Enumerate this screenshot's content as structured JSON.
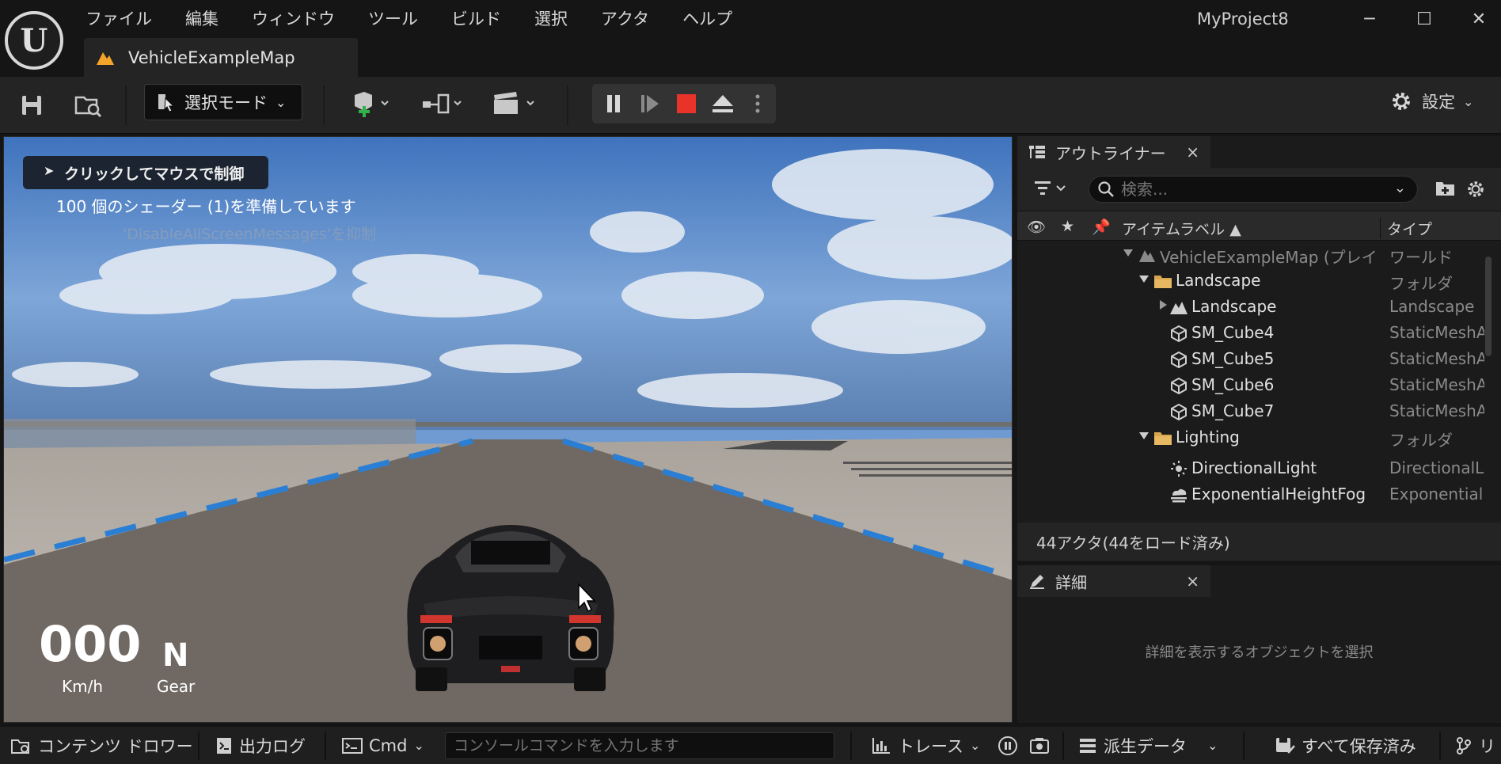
{
  "app": {
    "project_name": "MyProject8",
    "logo_letter": "U",
    "menu": [
      "ファイル",
      "編集",
      "ウィンドウ",
      "ツール",
      "ビルド",
      "選択",
      "アクタ",
      "ヘルプ"
    ],
    "window_controls": {
      "minimize": "─",
      "maximize": "☐",
      "close": "✕"
    },
    "document_tab": "VehicleExampleMap"
  },
  "toolbar": {
    "mode_label": "選択モード",
    "settings_label": "設定"
  },
  "viewport": {
    "click_hint": "クリックしてマウスで制御",
    "shader_message": "100 個のシェーダー (1)を準備しています",
    "suppress_message": "'DisableAllScreenMessages'を抑制",
    "speed_value": "000",
    "speed_unit": "Km/h",
    "gear_value": "N",
    "gear_label": "Gear"
  },
  "outliner": {
    "tab_label": "アウトライナー",
    "close": "×",
    "search_placeholder": "検索...",
    "columns": {
      "label": "アイテムラベル ▲",
      "type": "タイプ"
    },
    "rows": [
      {
        "name": "VehicleExampleMap (プレイ",
        "type": "ワールド",
        "icon": "map-icon"
      },
      {
        "name": "Landscape",
        "type": "フォルダ",
        "icon": "folder-icon"
      },
      {
        "name": "Landscape",
        "type": "Landscape",
        "icon": "landscape-icon"
      },
      {
        "name": "SM_Cube4",
        "type": "StaticMeshA",
        "icon": "static-mesh-icon"
      },
      {
        "name": "SM_Cube5",
        "type": "StaticMeshA",
        "icon": "static-mesh-icon"
      },
      {
        "name": "SM_Cube6",
        "type": "StaticMeshA",
        "icon": "static-mesh-icon"
      },
      {
        "name": "SM_Cube7",
        "type": "StaticMeshA",
        "icon": "static-mesh-icon"
      },
      {
        "name": "Lighting",
        "type": "フォルダ",
        "icon": "folder-icon"
      },
      {
        "name": "DirectionalLight",
        "type": "DirectionalLi",
        "icon": "directional-light-icon"
      },
      {
        "name": "ExponentialHeightFog",
        "type": "Exponentiall",
        "icon": "fog-icon"
      }
    ],
    "actor_count": "44アクタ(44をロード済み)"
  },
  "details": {
    "tab_label": "詳細",
    "close": "×",
    "empty_message": "詳細を表示するオブジェクトを選択"
  },
  "statusbar": {
    "content_drawer": "コンテンツ ドロワー",
    "output_log": "出力ログ",
    "cmd": "Cmd",
    "console_placeholder": "コンソールコマンドを入力します",
    "trace": "トレース",
    "derived_data": "派生データ",
    "save_all": "すべて保存済み",
    "revision": "リ"
  },
  "colors": {
    "accent_orange": "#f4a52a",
    "stop_red": "#e8332a",
    "add_green": "#2fb44a",
    "folder": "#d9a64e"
  }
}
